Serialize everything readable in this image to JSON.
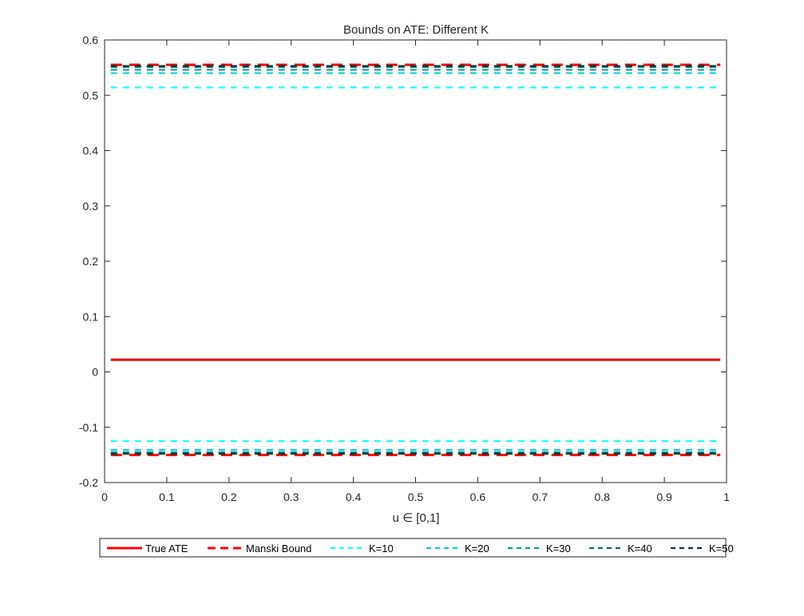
{
  "chart_data": {
    "type": "line",
    "title": "Bounds on ATE: Different K",
    "xlabel": "u ∈ [0,1]",
    "ylabel": "",
    "xlim": [
      0,
      1
    ],
    "ylim": [
      -0.2,
      0.6
    ],
    "xticks": [
      "0",
      "0.1",
      "0.2",
      "0.3",
      "0.4",
      "0.5",
      "0.6",
      "0.7",
      "0.8",
      "0.9",
      "1"
    ],
    "yticks": [
      "-0.2",
      "-0.1",
      "0",
      "0.1",
      "0.2",
      "0.3",
      "0.4",
      "0.5",
      "0.6"
    ],
    "grid": false,
    "legend_position": "bottom-outside",
    "x": [
      0.01,
      0.99
    ],
    "series": [
      {
        "name": "True ATE",
        "color": "#ff0000",
        "style": "solid",
        "values": [
          0.022,
          0.022
        ]
      },
      {
        "name": "Manski Bound",
        "color": "#ff0000",
        "style": "dashed",
        "upper": [
          0.555,
          0.555
        ],
        "lower": [
          -0.15,
          -0.15
        ]
      },
      {
        "name": "K=10",
        "color": "#00ffff",
        "style": "dashed",
        "upper": [
          0.514,
          0.514
        ],
        "lower": [
          -0.125,
          -0.125
        ]
      },
      {
        "name": "K=20",
        "color": "#00cccc",
        "style": "dashed",
        "upper": [
          0.54,
          0.54
        ],
        "lower": [
          -0.141,
          -0.141
        ]
      },
      {
        "name": "K=30",
        "color": "#009999",
        "style": "dashed",
        "upper": [
          0.546,
          0.546
        ],
        "lower": [
          -0.145,
          -0.145
        ]
      },
      {
        "name": "K=40",
        "color": "#006666",
        "style": "dashed",
        "upper": [
          0.551,
          0.551
        ],
        "lower": [
          -0.147,
          -0.147
        ]
      },
      {
        "name": "K=50",
        "color": "#003333",
        "style": "dashed",
        "upper": [
          0.553,
          0.553
        ],
        "lower": [
          -0.148,
          -0.148
        ]
      }
    ]
  }
}
